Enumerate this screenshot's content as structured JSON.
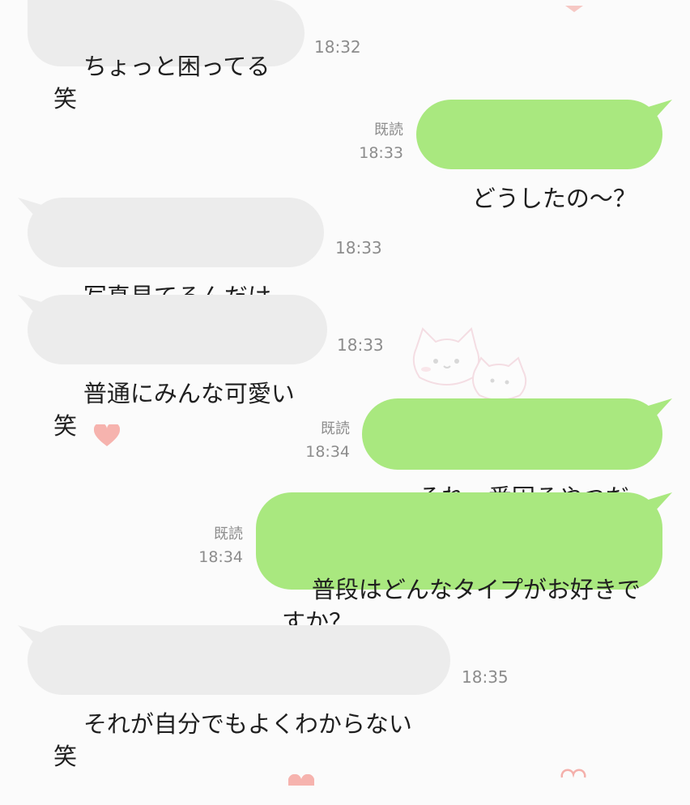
{
  "messages": [
    {
      "dir": "in",
      "text": "ちょっと困ってる笑",
      "time": "18:32"
    },
    {
      "dir": "out",
      "text": "どうしたの〜？",
      "time": "18:33",
      "read": "既読"
    },
    {
      "dir": "in",
      "text": "写真見てるんだけど、",
      "time": "18:33"
    },
    {
      "dir": "in",
      "text": "普通にみんな可愛い笑",
      "time": "18:33"
    },
    {
      "dir": "out",
      "text": "それ一番困るやつだ",
      "time": "18:34",
      "read": "既読"
    },
    {
      "dir": "out",
      "text": "普段はどんなタイプがお好きですか？",
      "time": "18:34",
      "read": "既読"
    },
    {
      "dir": "in",
      "text": "それが自分でもよくわからない笑",
      "time": "18:35"
    }
  ],
  "colors": {
    "background": "#fbfbfb",
    "incoming_bubble": "#ececec",
    "outgoing_bubble": "#a9e87f",
    "meta_text": "#8c8c8c",
    "heart": "#f6a9a6"
  },
  "icons": [
    "heart-icon",
    "cat-sticker-icon"
  ]
}
